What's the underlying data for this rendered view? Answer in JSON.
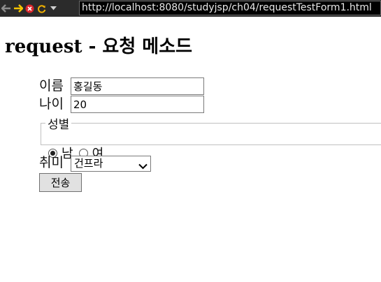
{
  "browser": {
    "url": "http://localhost:8080/studyjsp/ch04/requestTestForm1.html"
  },
  "page": {
    "title": "request - 요청 메소드"
  },
  "form": {
    "name_label": "이름",
    "name_value": "홍길동",
    "age_label": "나이",
    "age_value": "20",
    "gender_legend": "성별",
    "gender_options": [
      "남",
      "여"
    ],
    "gender_selected": "남",
    "hobby_label": "취미",
    "hobby_selected": "건프라",
    "submit_label": "전송"
  },
  "icons": [
    "back-icon",
    "forward-icon",
    "stop-icon",
    "reload-icon",
    "menu-dropdown-icon",
    "chevron-down-icon"
  ],
  "colors": {
    "toolbar": "#2b2b2b",
    "forward_arrow": "#f5c400",
    "stop": "#d9262d",
    "reload": "#f0b000"
  }
}
